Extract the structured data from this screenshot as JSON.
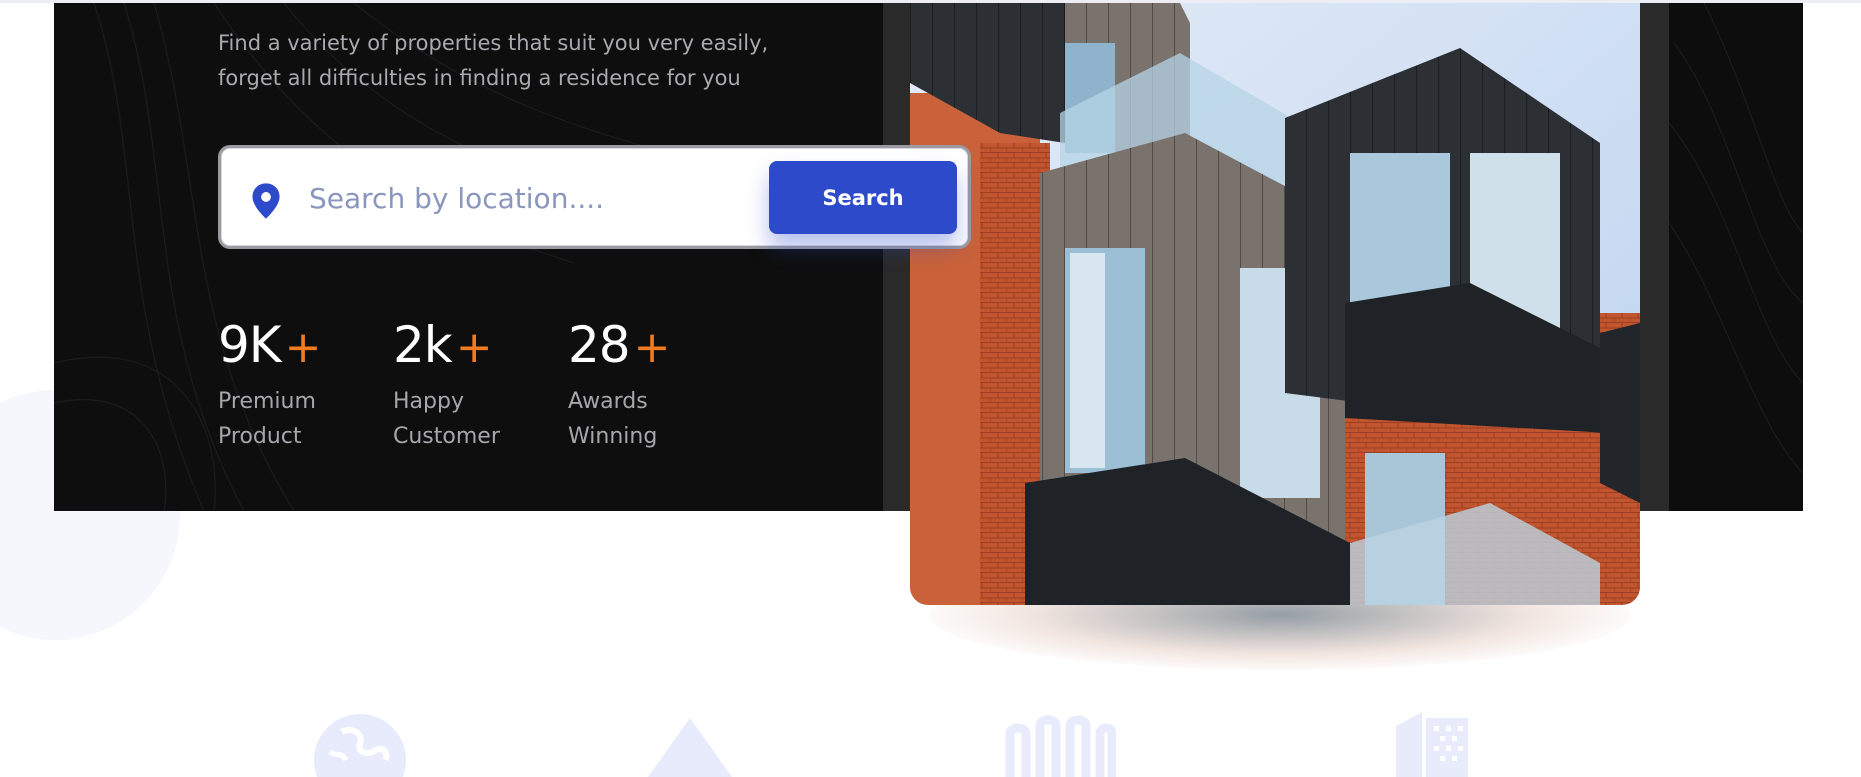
{
  "hero": {
    "subtitle_line1": "Find a variety of properties that suit you very easily,",
    "subtitle_line2": "forget all  difficulties in finding a residence for you"
  },
  "search": {
    "placeholder": "Search by location....",
    "button_label": "Search",
    "icon": "location-pin-icon"
  },
  "stats": [
    {
      "value": "9K",
      "suffix": "+",
      "label_line1": "Premium",
      "label_line2": "Product"
    },
    {
      "value": "2k",
      "suffix": "+",
      "label_line1": "Happy",
      "label_line2": "Customer"
    },
    {
      "value": "28",
      "suffix": "+",
      "label_line1": "Awards",
      "label_line2": "Winning"
    }
  ],
  "partner_logos": [
    "globe-logo-icon",
    "mountain-logo-icon",
    "bars-logo-icon",
    "building-logo-icon"
  ],
  "colors": {
    "hero_background": "#0d0d0d",
    "accent_orange": "#f07b20",
    "button_blue": "#2d4acb",
    "placeholder_text": "#8a96bd",
    "logo_tint": "#e8ebfb"
  }
}
